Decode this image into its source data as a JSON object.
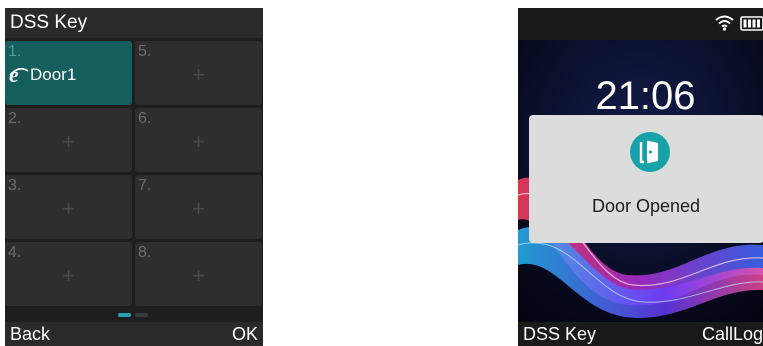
{
  "dss_screen": {
    "title": "DSS Key",
    "keys": [
      {
        "number": "1.",
        "label": "Door1",
        "icon": "ie-icon",
        "active": true
      },
      {
        "number": "2.",
        "label": "+"
      },
      {
        "number": "3.",
        "label": "+"
      },
      {
        "number": "4.",
        "label": "+"
      },
      {
        "number": "5.",
        "label": "+"
      },
      {
        "number": "6.",
        "label": "+"
      },
      {
        "number": "7.",
        "label": "+"
      },
      {
        "number": "8.",
        "label": "+"
      }
    ],
    "page_indicator": {
      "pages": 2,
      "current": 1
    },
    "softkeys": {
      "left": "Back",
      "right": "OK"
    }
  },
  "idle_screen": {
    "status_icons": [
      "wifi-icon",
      "battery-icon"
    ],
    "time": "21:06",
    "popup": {
      "icon": "door-open-icon",
      "message": "Door Opened"
    },
    "softkeys": {
      "left": "DSS Key",
      "right": "CallLog"
    }
  },
  "colors": {
    "accent_teal": "#155e5e",
    "dot_active": "#1ea3b5",
    "door_icon": "#16a2a6",
    "popup_bg": "#dcdcdc",
    "screen_bg": "#1e1e1e"
  }
}
